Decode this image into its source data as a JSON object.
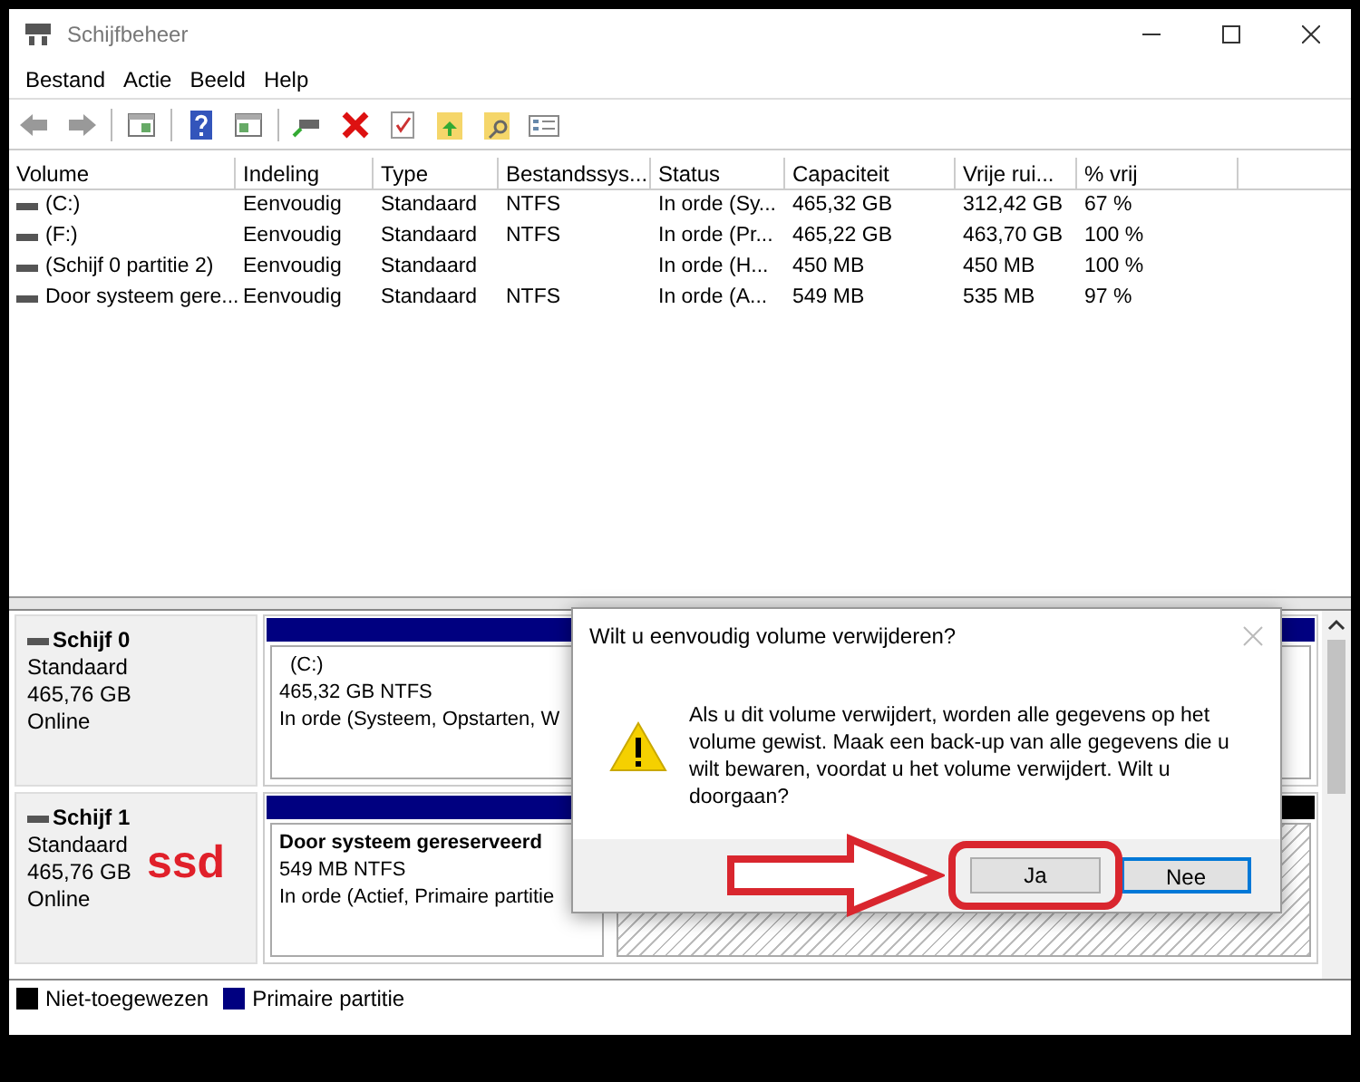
{
  "window": {
    "title": "Schijfbeheer"
  },
  "menu": [
    "Bestand",
    "Actie",
    "Beeld",
    "Help"
  ],
  "volume_table": {
    "columns": [
      "Volume",
      "Indeling",
      "Type",
      "Bestandssys...",
      "Status",
      "Capaciteit",
      "Vrije rui...",
      "% vrij"
    ],
    "rows": [
      [
        "(C:)",
        "Eenvoudig",
        "Standaard",
        "NTFS",
        "In orde (Sy...",
        "465,32 GB",
        "312,42 GB",
        "67 %"
      ],
      [
        "(F:)",
        "Eenvoudig",
        "Standaard",
        "NTFS",
        "In orde (Pr...",
        "465,22 GB",
        "463,70 GB",
        "100 %"
      ],
      [
        "(Schijf 0 partitie 2)",
        "Eenvoudig",
        "Standaard",
        "",
        "In orde (H...",
        "450 MB",
        "450 MB",
        "100 %"
      ],
      [
        "Door systeem gere...",
        "Eenvoudig",
        "Standaard",
        "NTFS",
        "In orde (A...",
        "549 MB",
        "535 MB",
        "97 %"
      ]
    ]
  },
  "disks": [
    {
      "name": "Schijf 0",
      "type": "Standaard",
      "size": "465,76 GB",
      "state": "Online",
      "partitions": [
        {
          "kind": "primary",
          "title": "(C:)",
          "size": "465,32 GB NTFS",
          "status": "In orde (Systeem, Opstarten, W"
        }
      ]
    },
    {
      "name": "Schijf 1",
      "type": "Standaard",
      "size": "465,76 GB",
      "state": "Online",
      "note": "ssd",
      "partitions": [
        {
          "kind": "primary",
          "title": "Door systeem gereserveerd",
          "size": "549 MB NTFS",
          "status": "In orde (Actief, Primaire partitie"
        },
        {
          "kind": "unallocated"
        }
      ]
    }
  ],
  "legend": [
    {
      "label": "Niet-toegewezen",
      "color": "#000000"
    },
    {
      "label": "Primaire partitie",
      "color": "#000080"
    }
  ],
  "dialog": {
    "title": "Wilt u eenvoudig volume verwijderen?",
    "message": "Als u dit volume verwijdert, worden alle gegevens op het volume gewist. Maak een back-up van alle gegevens die u wilt bewaren, voordat u het volume verwijdert. Wilt u doorgaan?",
    "buttons": [
      {
        "label": "Ja",
        "default": false,
        "highlighted": true
      },
      {
        "label": "Nee",
        "default": true,
        "highlighted": false
      }
    ]
  }
}
